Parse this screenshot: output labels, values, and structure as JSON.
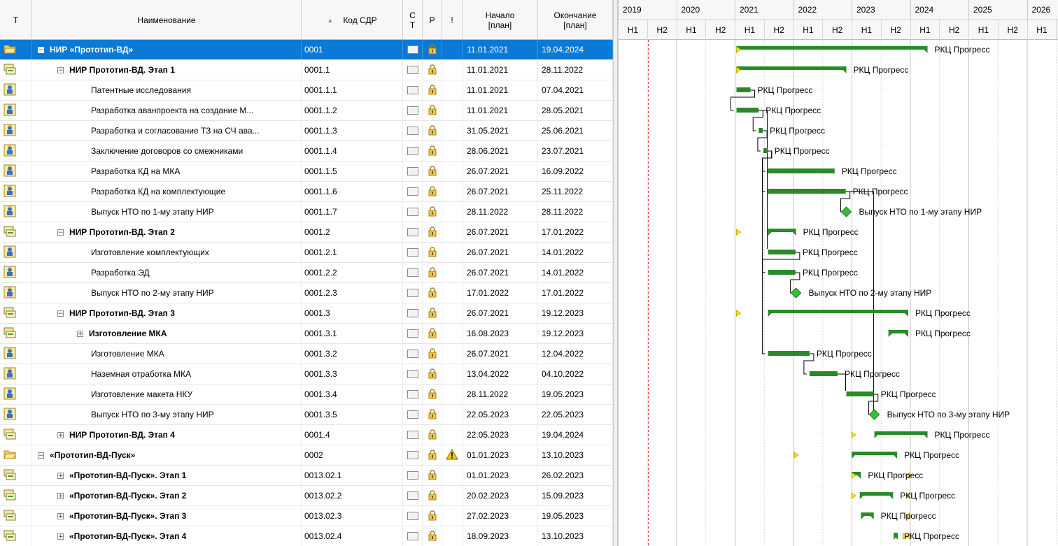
{
  "columns": {
    "t": "Т",
    "name": "Наименование",
    "code": "Код СДР",
    "st": "С\nТ",
    "r": "Р",
    "ex": "!",
    "start": "Начало\n[план]",
    "end": "Окончание\n[план]"
  },
  "timeline": {
    "years": [
      "2019",
      "2020",
      "2021",
      "2022",
      "2023",
      "2024",
      "2025",
      "2026"
    ],
    "half_labels": [
      "H1",
      "H2"
    ]
  },
  "rows": [
    {
      "name": "НИР «Прототип-ВД»",
      "code": "0001",
      "start": "11.01.2021",
      "end": "19.04.2024",
      "level": 0,
      "bold": true,
      "expander": "minus",
      "icon": "folder-open-icon",
      "selected": true,
      "start_num": 2021.03,
      "end_num": 2024.3,
      "bar": "summary",
      "label": "РКЦ Прогресс",
      "dep_mark": 2021.03
    },
    {
      "name": "НИР Прототип-ВД. Этап 1",
      "code": "0001.1",
      "start": "11.01.2021",
      "end": "28.11.2022",
      "level": 1,
      "bold": true,
      "expander": "minus",
      "icon": "summary-task-icon",
      "start_num": 2021.03,
      "end_num": 2022.91,
      "bar": "summary",
      "label": "РКЦ Прогресс",
      "dep_mark": 2021.03
    },
    {
      "name": "Патентные исследования",
      "code": "0001.1.1",
      "start": "11.01.2021",
      "end": "07.04.2021",
      "level": 2,
      "icon": "worker-task-icon",
      "start_num": 2021.03,
      "end_num": 2021.27,
      "bar": "task",
      "label": "РКЦ Прогресс"
    },
    {
      "name": "Разработка аванпроекта на создание М...",
      "code": "0001.1.2",
      "start": "11.01.2021",
      "end": "28.05.2021",
      "level": 2,
      "icon": "worker-task-icon",
      "start_num": 2021.03,
      "end_num": 2021.41,
      "bar": "task",
      "label": "РКЦ Прогресс"
    },
    {
      "name": "Разработка и согласование ТЗ на СЧ ава...",
      "code": "0001.1.3",
      "start": "31.05.2021",
      "end": "25.06.2021",
      "level": 2,
      "icon": "worker-task-icon",
      "start_num": 2021.41,
      "end_num": 2021.48,
      "bar": "task",
      "label": "РКЦ Прогресс"
    },
    {
      "name": "Заключение договоров со смежниками",
      "code": "0001.1.4",
      "start": "28.06.2021",
      "end": "23.07.2021",
      "level": 2,
      "icon": "worker-task-icon",
      "start_num": 2021.49,
      "end_num": 2021.56,
      "bar": "task",
      "label": "РКЦ Прогресс"
    },
    {
      "name": "Разработка КД на МКА",
      "code": "0001.1.5",
      "start": "26.07.2021",
      "end": "16.09.2022",
      "level": 2,
      "icon": "worker-task-icon",
      "start_num": 2021.57,
      "end_num": 2022.71,
      "bar": "task",
      "label": "РКЦ Прогресс"
    },
    {
      "name": "Разработка КД на комплектующие",
      "code": "0001.1.6",
      "start": "26.07.2021",
      "end": "25.11.2022",
      "level": 2,
      "icon": "worker-task-icon",
      "start_num": 2021.57,
      "end_num": 2022.9,
      "bar": "task",
      "label": "РКЦ Прогресс"
    },
    {
      "name": "Выпуск НТО по 1-му этапу НИР",
      "code": "0001.1.7",
      "start": "28.11.2022",
      "end": "28.11.2022",
      "level": 2,
      "icon": "worker-task-icon",
      "start_num": 2022.91,
      "end_num": 2022.91,
      "bar": "milestone",
      "label": "Выпуск НТО по 1-му этапу НИР"
    },
    {
      "name": "НИР Прототип-ВД. Этап 2",
      "code": "0001.2",
      "start": "26.07.2021",
      "end": "17.01.2022",
      "level": 1,
      "bold": true,
      "expander": "minus",
      "icon": "summary-task-icon",
      "start_num": 2021.57,
      "end_num": 2022.05,
      "bar": "summary",
      "label": "РКЦ Прогресс",
      "dep_mark": 2021.03
    },
    {
      "name": "Изготовление комплектующих",
      "code": "0001.2.1",
      "start": "26.07.2021",
      "end": "14.01.2022",
      "level": 2,
      "icon": "worker-task-icon",
      "start_num": 2021.57,
      "end_num": 2022.04,
      "bar": "task",
      "label": "РКЦ Прогресс"
    },
    {
      "name": "Разработка ЭД",
      "code": "0001.2.2",
      "start": "26.07.2021",
      "end": "14.01.2022",
      "level": 2,
      "icon": "worker-task-icon",
      "start_num": 2021.57,
      "end_num": 2022.04,
      "bar": "task",
      "label": "РКЦ Прогресс"
    },
    {
      "name": "Выпуск НТО по 2-му этапу НИР",
      "code": "0001.2.3",
      "start": "17.01.2022",
      "end": "17.01.2022",
      "level": 2,
      "icon": "worker-task-icon",
      "start_num": 2022.05,
      "end_num": 2022.05,
      "bar": "milestone",
      "label": "Выпуск НТО по 2-му этапу НИР"
    },
    {
      "name": "НИР Прототип-ВД. Этап 3",
      "code": "0001.3",
      "start": "26.07.2021",
      "end": "19.12.2023",
      "level": 1,
      "bold": true,
      "expander": "minus",
      "icon": "summary-task-icon",
      "start_num": 2021.57,
      "end_num": 2023.97,
      "bar": "summary",
      "label": "РКЦ Прогресс",
      "dep_mark": 2021.03
    },
    {
      "name": "Изготовление МКА",
      "code": "0001.3.1",
      "start": "16.08.2023",
      "end": "19.12.2023",
      "level": 2,
      "bold": true,
      "expander": "plus",
      "icon": "summary-task-icon",
      "start_num": 2023.63,
      "end_num": 2023.97,
      "bar": "summary",
      "label": "РКЦ Прогресс"
    },
    {
      "name": "Изготовление МКА",
      "code": "0001.3.2",
      "start": "26.07.2021",
      "end": "12.04.2022",
      "level": 2,
      "icon": "worker-task-icon",
      "start_num": 2021.57,
      "end_num": 2022.28,
      "bar": "task",
      "label": "РКЦ Прогресс"
    },
    {
      "name": "Наземная отработка МКА",
      "code": "0001.3.3",
      "start": "13.04.2022",
      "end": "04.10.2022",
      "level": 2,
      "icon": "worker-task-icon",
      "start_num": 2022.28,
      "end_num": 2022.76,
      "bar": "task",
      "label": "РКЦ Прогресс"
    },
    {
      "name": "Изготовление макета НКУ",
      "code": "0001.3.4",
      "start": "28.11.2022",
      "end": "19.05.2023",
      "level": 2,
      "icon": "worker-task-icon",
      "start_num": 2022.91,
      "end_num": 2023.38,
      "bar": "task",
      "label": "РКЦ Прогресс"
    },
    {
      "name": "Выпуск НТО по 3-му этапу НИР",
      "code": "0001.3.5",
      "start": "22.05.2023",
      "end": "22.05.2023",
      "level": 2,
      "icon": "worker-task-icon",
      "start_num": 2023.39,
      "end_num": 2023.39,
      "bar": "milestone",
      "label": "Выпуск НТО по 3-му этапу НИР"
    },
    {
      "name": "НИР Прототип-ВД. Этап 4",
      "code": "0001.4",
      "start": "22.05.2023",
      "end": "19.04.2024",
      "level": 1,
      "bold": true,
      "expander": "plus",
      "icon": "summary-task-icon",
      "start_num": 2023.39,
      "end_num": 2024.3,
      "bar": "summary",
      "label": "РКЦ Прогресс",
      "dep_mark": 2023.0
    },
    {
      "name": "«Прототип-ВД-Пуск»",
      "code": "0002",
      "start": "01.01.2023",
      "end": "13.10.2023",
      "level": 0,
      "bold": true,
      "expander": "minus",
      "icon": "folder-icon",
      "warning": true,
      "start_num": 2023.0,
      "end_num": 2023.78,
      "bar": "summary",
      "label": "РКЦ Прогресс",
      "dep_mark": 2022.02
    },
    {
      "name": "«Прототип-ВД-Пуск». Этап 1",
      "code": "0013.02.1",
      "start": "01.01.2023",
      "end": "26.02.2023",
      "level": 1,
      "bold": true,
      "expander": "plus",
      "icon": "summary-task-icon",
      "start_num": 2023.0,
      "end_num": 2023.16,
      "bar": "summary",
      "label": "РКЦ Прогресс",
      "dep_mark": 2023.0,
      "end_mark": 2024.0
    },
    {
      "name": "«Прототип-ВД-Пуск». Этап 2",
      "code": "0013.02.2",
      "start": "20.02.2023",
      "end": "15.09.2023",
      "level": 1,
      "bold": true,
      "expander": "plus",
      "icon": "summary-task-icon",
      "start_num": 2023.14,
      "end_num": 2023.71,
      "bar": "summary",
      "label": "РКЦ Прогресс",
      "dep_mark": 2023.0,
      "end_mark": 2024.0
    },
    {
      "name": "«Прототип-ВД-Пуск». Этап 3",
      "code": "0013.02.3",
      "start": "27.02.2023",
      "end": "19.05.2023",
      "level": 1,
      "bold": true,
      "expander": "plus",
      "icon": "summary-task-icon",
      "start_num": 2023.16,
      "end_num": 2023.38,
      "bar": "summary",
      "label": "РКЦ Прогресс",
      "end_mark": 2024.0
    },
    {
      "name": "«Прототип-ВД-Пуск». Этап 4",
      "code": "0013.02.4",
      "start": "18.09.2023",
      "end": "13.10.2023",
      "level": 1,
      "bold": true,
      "expander": "plus",
      "icon": "summary-task-icon",
      "start_num": 2023.72,
      "end_num": 2023.78,
      "bar": "summary",
      "label": "РКЦ Прогресс",
      "dep_mark": 2023.88,
      "end_mark": 2024.0
    }
  ],
  "status_date": 2019.52,
  "colors": {
    "bar": "#2a8a2a",
    "milestone": "#35c235",
    "marker": "#f5e628",
    "status_line": "#e02020",
    "selection": "#0a7ad6"
  }
}
